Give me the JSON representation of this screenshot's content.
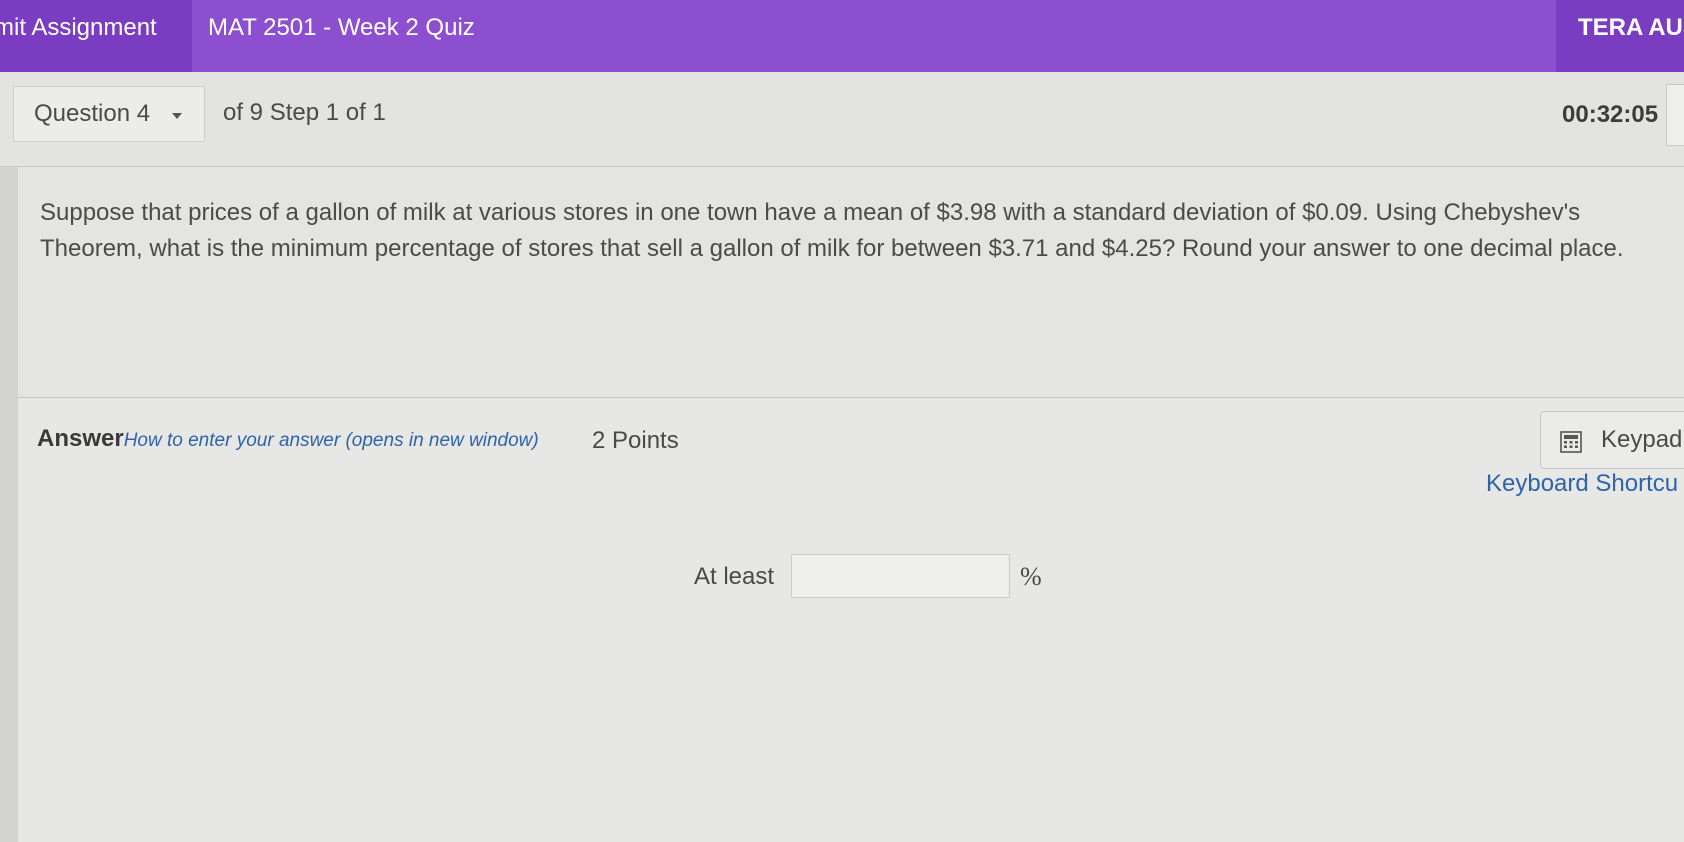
{
  "topbar": {
    "submit_label": "mit Assignment",
    "quiz_title": "MAT 2501 - Week 2 Quiz",
    "user_name": "TERA AUS",
    "color": "#8c4fd0"
  },
  "question_nav": {
    "selected_question": "Question 4",
    "step_info": "of 9 Step 1 of 1",
    "timer": "00:32:05"
  },
  "question": {
    "text": "Suppose that prices of a gallon of milk at various stores in one town have a mean of $3.98 with a standard deviation of $0.09. Using Chebyshev's Theorem, what is the minimum percentage of stores that sell a gallon of milk for between $3.71 and $4.25? Round your answer to one decimal place."
  },
  "answer": {
    "title": "Answer",
    "how_to_link": "How to enter your answer (opens in new window)",
    "points": "2 Points",
    "keypad_label": "Keypad",
    "keypad_icon": "calculator-icon",
    "shortcuts_label": "Keyboard Shortcu",
    "prefix": "At least",
    "input_value": "",
    "suffix": "%",
    "link_color": "#2f64a8"
  }
}
